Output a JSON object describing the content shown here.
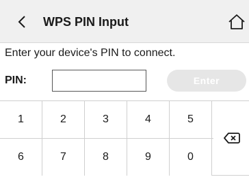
{
  "header": {
    "title": "WPS PIN Input",
    "back_icon": "chevron-left-icon",
    "home_icon": "home-icon"
  },
  "instruction": "Enter your device's PIN to connect.",
  "pin": {
    "label": "PIN:",
    "value": "",
    "placeholder": ""
  },
  "enter_button": {
    "label": "Enter",
    "state": "disabled"
  },
  "keypad": {
    "row1": [
      "1",
      "2",
      "3",
      "4",
      "5"
    ],
    "row2": [
      "6",
      "7",
      "8",
      "9",
      "0"
    ],
    "backspace_icon": "backspace-icon"
  },
  "colors": {
    "header_bg": "#f0f0f0",
    "button_disabled_bg": "#e6e6e6",
    "divider": "#cfcfcf"
  }
}
